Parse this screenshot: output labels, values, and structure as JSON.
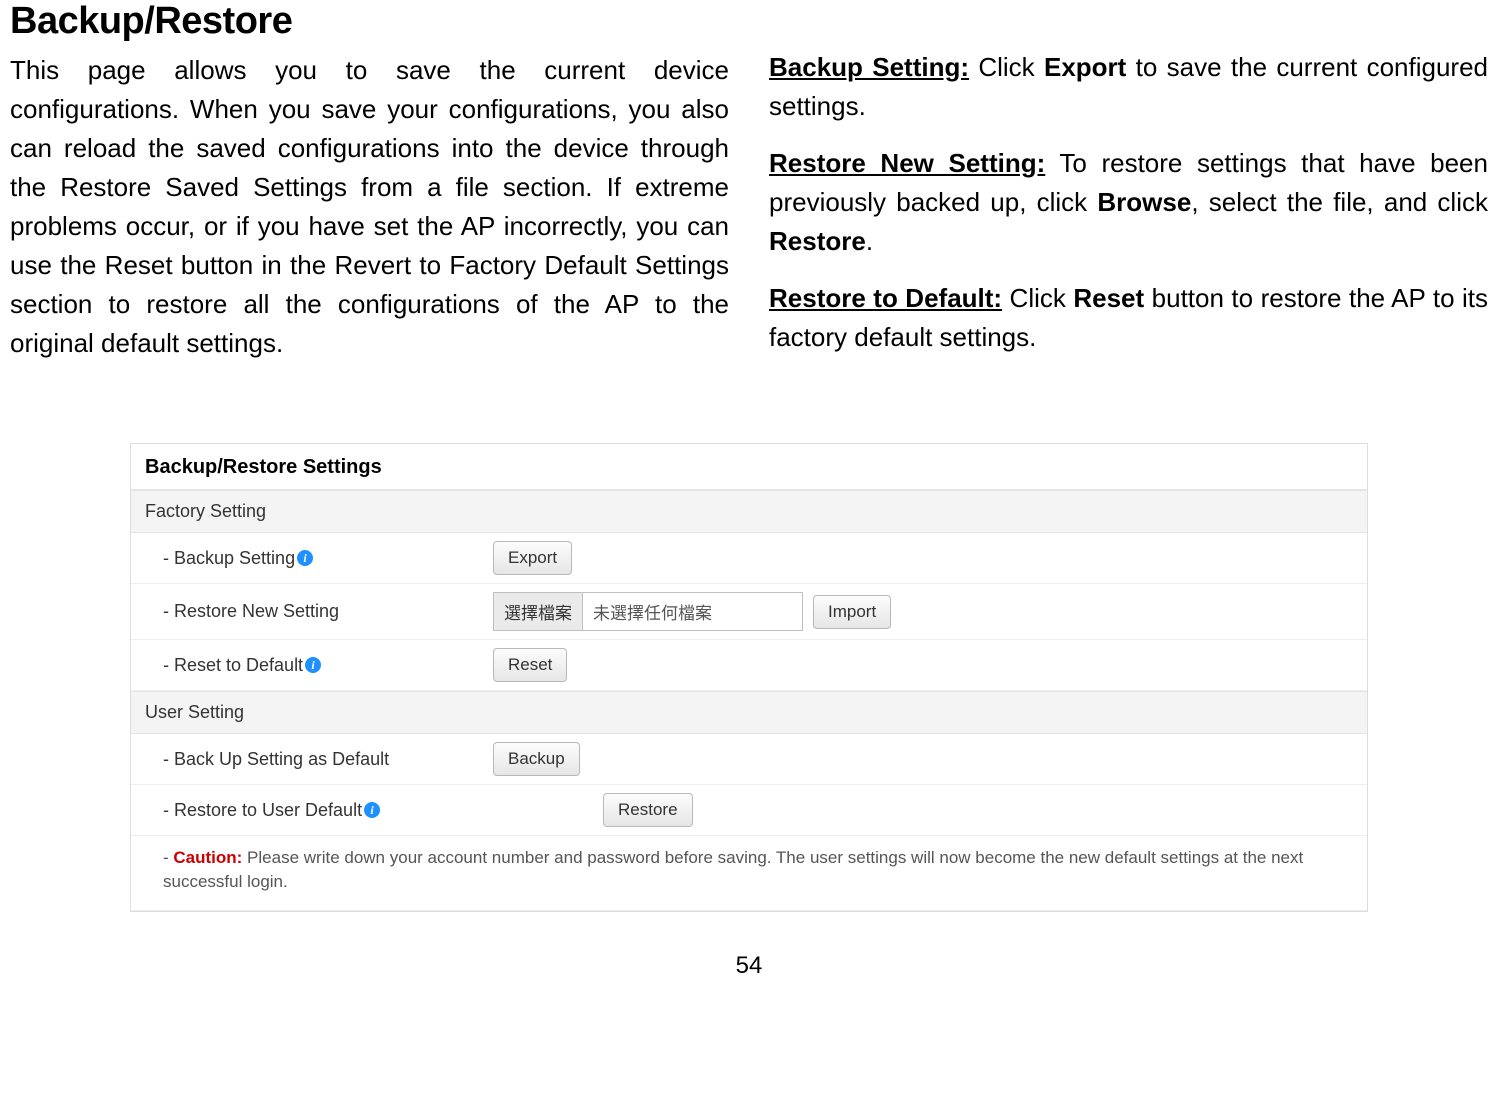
{
  "header": {
    "title": "Backup/Restore"
  },
  "left_paragraph": "This page allows you to save the current device configurations. When you save your configurations, you also can reload the saved configurations into the device through the Restore Saved Settings from a file section. If extreme problems occur, or if you have set the AP incorrectly, you can use the Reset button in the Revert to Factory Default Settings section to restore all the configurations of the AP to the original default settings.",
  "right": {
    "p1_prefix": "Backup Setting:",
    "p1_mid": " Click ",
    "p1_bold": "Export",
    "p1_suffix": " to save the current configured settings.",
    "p2_prefix": "Restore New Setting:",
    "p2_mid": " To restore settings that have been previously backed up, click ",
    "p2_bold": "Browse",
    "p2_mid2": ", select the file, and click ",
    "p2_bold2": "Restore",
    "p2_suffix": ".",
    "p3_prefix": "Restore to Default:",
    "p3_mid": " Click ",
    "p3_bold": "Reset",
    "p3_suffix": " button to restore the AP to its factory default settings."
  },
  "panel": {
    "title": "Backup/Restore Settings",
    "section1": "Factory Setting",
    "row1_label": "- Backup Setting",
    "row1_button": "Export",
    "row2_label": "- Restore New Setting",
    "row2_choose": "選擇檔案",
    "row2_nofile": "未選擇任何檔案",
    "row2_button": "Import",
    "row3_label": "- Reset to Default",
    "row3_button": "Reset",
    "section2": "User Setting",
    "row4_label": "- Back Up Setting as Default",
    "row4_button": "Backup",
    "row5_label": "- Restore to User Default",
    "row5_button": "Restore",
    "caution_prefix": "- ",
    "caution_label": "Caution:",
    "caution_text": " Please write down your account number and password before saving. The user settings will now become the new default settings at the next successful login."
  },
  "info_glyph": "i",
  "page_number": "54"
}
